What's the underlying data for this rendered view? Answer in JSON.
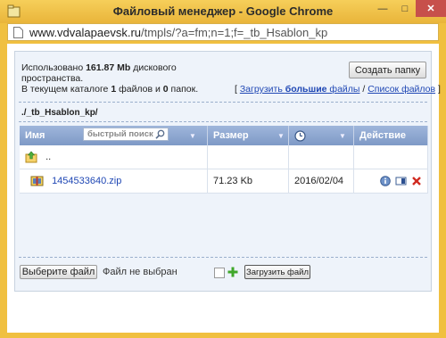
{
  "window": {
    "title": "Файловый менеджер - Google Chrome"
  },
  "address": {
    "domain": "www.vdvalapaevsk.ru",
    "path": "/tmpls/?a=fm;n=1;f=_tb_Hsablon_kp"
  },
  "info": {
    "used_prefix": "Использовано ",
    "used_value": "161.87 Mb",
    "used_suffix": " дискового",
    "line2": "пространства.",
    "in_dir_prefix": "В текущем каталоге ",
    "files_count": "1",
    "files_word": " файлов и ",
    "folders_count": "0",
    "folders_word": " папок."
  },
  "create_folder_button": "Создать папку",
  "links": {
    "open_bracket": "[ ",
    "upload_prefix": "Загрузить ",
    "upload_bold": "большие",
    "upload_suffix": " файлы",
    "separator": " / ",
    "file_list": "Список файлов",
    "close_bracket": " ]"
  },
  "current_path": "./_tb_Hsablon_kp/",
  "table": {
    "col_name": "Имя",
    "search_placeholder": "быстрый поиск",
    "col_size": "Размер",
    "col_action": "Действие",
    "parent_dir": "..",
    "rows": [
      {
        "name": "1454533640.zip",
        "size": "71.23 Kb",
        "date": "2016/02/04"
      }
    ]
  },
  "upload": {
    "choose_file_button": "Выберите файл",
    "no_file_text": "Файл не выбран",
    "upload_button": "Загрузить файл"
  }
}
